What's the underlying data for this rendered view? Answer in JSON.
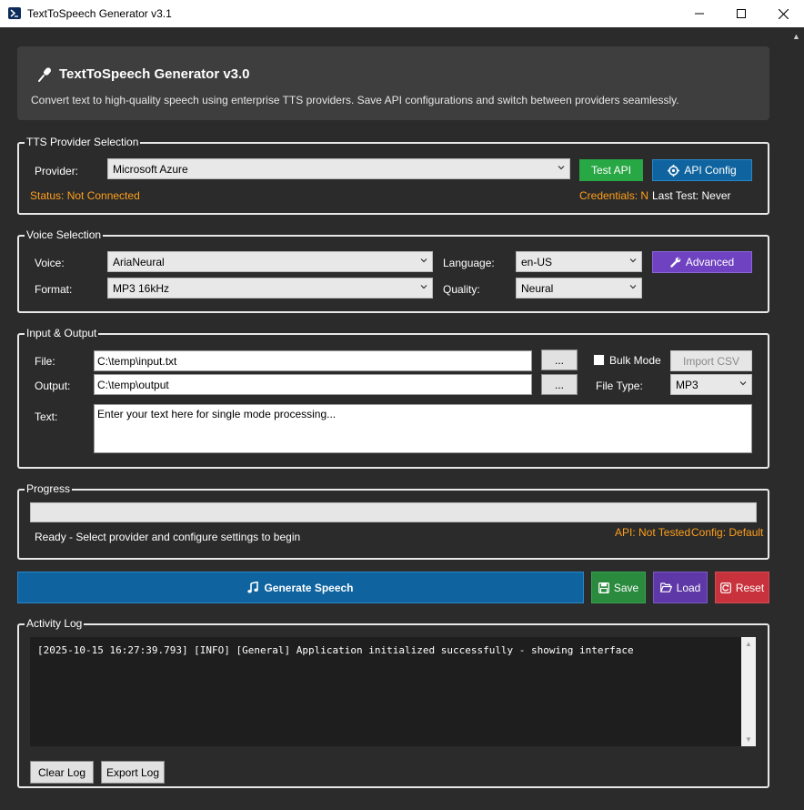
{
  "window": {
    "title": "TextToSpeech Generator v3.1",
    "minimize_icon": "minimize-icon",
    "maximize_icon": "maximize-icon",
    "close_icon": "close-icon"
  },
  "header": {
    "title": "TextToSpeech Generator v3.0",
    "description": "Convert text to high-quality speech using enterprise TTS providers. Save API configurations and switch between providers seamlessly."
  },
  "provider_section": {
    "legend": "TTS Provider Selection",
    "provider_label": "Provider:",
    "provider_value": "Microsoft Azure",
    "test_api_label": "Test API",
    "api_config_label": "API Config",
    "status_text": "Status: Not Connected",
    "credentials_text": "Credentials: N",
    "last_test_text": "Last Test: Never"
  },
  "voice_section": {
    "legend": "Voice Selection",
    "voice_label": "Voice:",
    "voice_value": "AriaNeural",
    "language_label": "Language:",
    "language_value": "en-US",
    "advanced_label": "Advanced",
    "format_label": "Format:",
    "format_value": "MP3 16kHz",
    "quality_label": "Quality:",
    "quality_value": "Neural"
  },
  "io_section": {
    "legend": "Input & Output",
    "file_label": "File:",
    "file_value": "C:\\temp\\input.txt",
    "browse_label": "...",
    "bulk_mode_label": "Bulk Mode",
    "import_csv_label": "Import CSV",
    "output_label": "Output:",
    "output_value": "C:\\temp\\output",
    "file_type_label": "File Type:",
    "file_type_value": "MP3",
    "text_label": "Text:",
    "text_placeholder": "Enter your text here for single mode processing..."
  },
  "progress_section": {
    "legend": "Progress",
    "progress_value": 0,
    "status_text": "Ready - Select provider and configure settings to begin",
    "api_status": "API: Not Tested",
    "config_status": "Config: Default"
  },
  "actions": {
    "generate_label": "Generate Speech",
    "save_label": "Save",
    "load_label": "Load",
    "reset_label": "Reset"
  },
  "log_section": {
    "legend": "Activity Log",
    "entries": [
      "[2025-10-15 16:27:39.793] [INFO] [General] Application initialized successfully - showing interface"
    ],
    "clear_label": "Clear Log",
    "export_label": "Export Log"
  },
  "colors": {
    "background": "#2b2b2b",
    "accent_green": "#28a745",
    "accent_blue": "#0f64a0",
    "accent_purple": "#6f42c1",
    "accent_red": "#c8323c",
    "warning_orange": "#ff9f1a"
  }
}
